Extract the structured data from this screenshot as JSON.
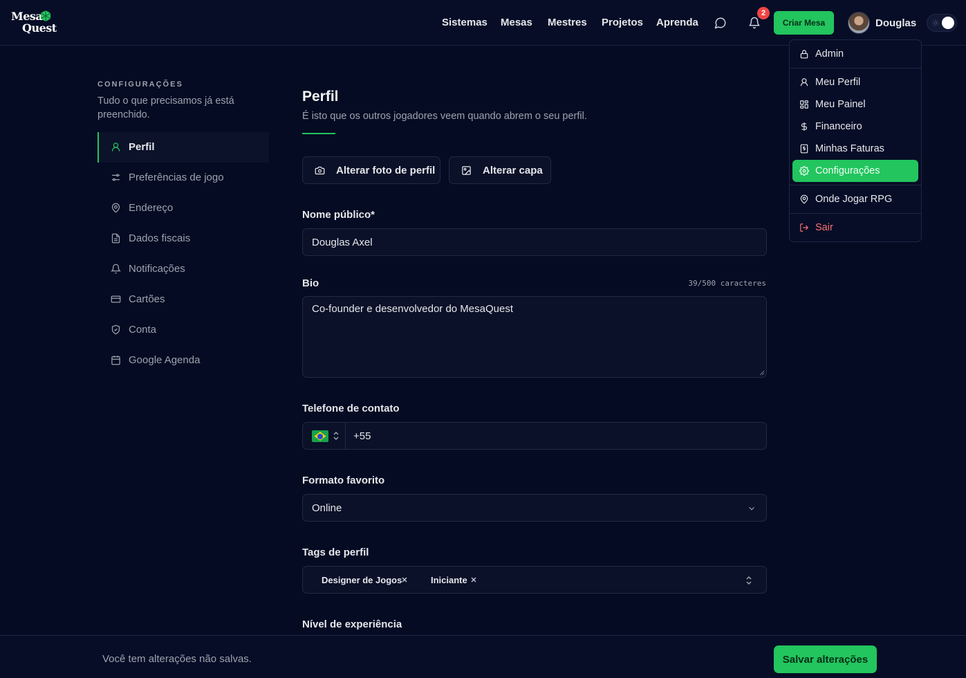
{
  "brand": {
    "line1": "Mesa",
    "line2": "Quest",
    "logo_icon": "d20-die-icon"
  },
  "nav": {
    "links": [
      "Sistemas",
      "Mesas",
      "Mestres",
      "Projetos",
      "Aprenda"
    ],
    "notification_count": "2",
    "create_label": "Criar Mesa",
    "user_name": "Douglas"
  },
  "sidebar": {
    "kicker": "CONFIGURAÇÕES",
    "description": "Tudo o que precisamos já está preenchido.",
    "items": [
      {
        "label": "Perfil",
        "icon": "user-icon",
        "active": true
      },
      {
        "label": "Preferências de jogo",
        "icon": "sliders-icon"
      },
      {
        "label": "Endereço",
        "icon": "map-pin-icon"
      },
      {
        "label": "Dados fiscais",
        "icon": "document-icon"
      },
      {
        "label": "Notificações",
        "icon": "bell-icon"
      },
      {
        "label": "Cartões",
        "icon": "credit-card-icon"
      },
      {
        "label": "Conta",
        "icon": "shield-icon"
      },
      {
        "label": "Google Agenda",
        "icon": "calendar-icon"
      }
    ]
  },
  "profile": {
    "title": "Perfil",
    "subtitle": "É isto que os outros jogadores veem quando abrem o seu perfil.",
    "change_photo_label": "Alterar foto de perfil",
    "change_cover_label": "Alterar capa",
    "public_name_label": "Nome público*",
    "public_name_value": "Douglas Axel",
    "bio_label": "Bio",
    "bio_counter": "39/500 caracteres",
    "bio_value": "Co-founder e desenvolvedor do MesaQuest",
    "phone_label": "Telefone de contato",
    "phone_country": "BR",
    "phone_value": "+55",
    "format_label": "Formato favorito",
    "format_value": "Online",
    "tags_label": "Tags de perfil",
    "tags": [
      "Designer de Jogos",
      "Iniciante"
    ],
    "experience_label": "Nível de experiência"
  },
  "user_menu": {
    "items": [
      {
        "label": "Admin",
        "icon": "lock-icon"
      },
      {
        "label": "Meu Perfil",
        "icon": "user-icon"
      },
      {
        "label": "Meu Painel",
        "icon": "dashboard-icon"
      },
      {
        "label": "Financeiro",
        "icon": "dollar-icon"
      },
      {
        "label": "Minhas Faturas",
        "icon": "invoice-icon"
      },
      {
        "label": "Configurações",
        "icon": "gear-icon",
        "active": true
      },
      {
        "label": "Onde Jogar RPG",
        "icon": "map-pin-icon"
      },
      {
        "label": "Sair",
        "icon": "logout-icon",
        "danger": true
      }
    ]
  },
  "footer": {
    "unsaved_text": "Você tem alterações não salvas.",
    "save_label": "Salvar alterações"
  },
  "colors": {
    "accent": "#22c55e",
    "background": "#050b22",
    "danger": "#ef4444"
  }
}
